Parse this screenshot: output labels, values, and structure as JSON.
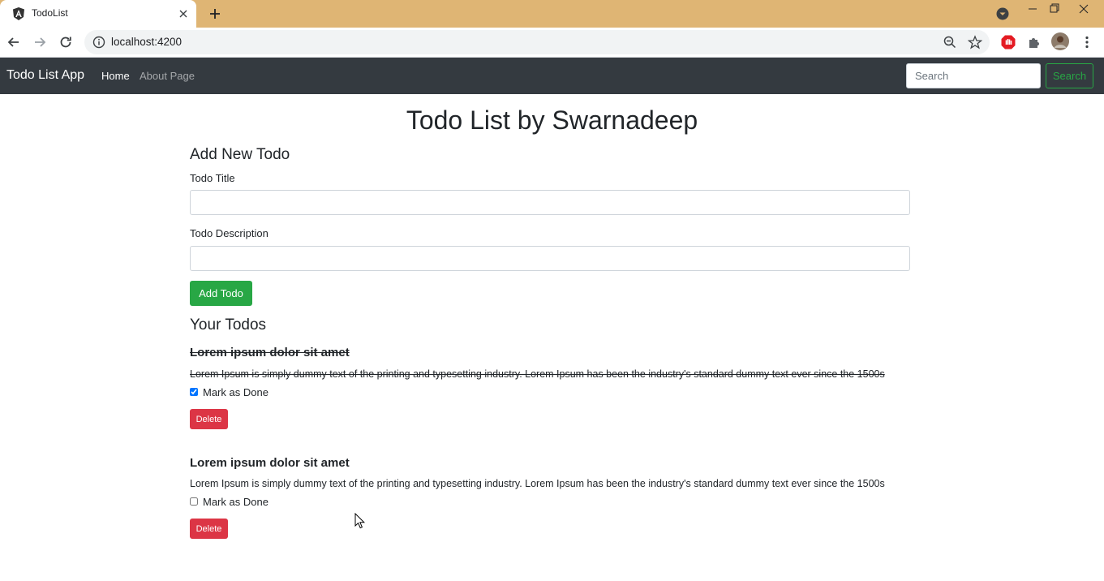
{
  "browser": {
    "tab_title": "TodoList",
    "url": "localhost:4200",
    "icons": [
      "angular-favicon",
      "close-icon",
      "plus-icon",
      "tab-search-icon",
      "minimize-icon",
      "restore-icon",
      "window-close-icon",
      "back-arrow-icon",
      "forward-arrow-icon",
      "reload-icon",
      "info-icon",
      "zoom-icon",
      "star-icon",
      "adblock-icon",
      "extensions-icon",
      "avatar",
      "kebab-menu-icon"
    ],
    "colors": {
      "tab_strip": "#dfb574",
      "close_hover": "#e81123"
    }
  },
  "navbar": {
    "brand": "Todo List App",
    "links": [
      {
        "label": "Home",
        "active": true
      },
      {
        "label": "About Page",
        "active": false
      }
    ],
    "search_placeholder": "Search",
    "search_button": "Search",
    "colors": {
      "background": "#343a40",
      "search_button": "#28a745"
    }
  },
  "main": {
    "title": "Todo List by Swarnadeep",
    "add_form": {
      "heading": "Add New Todo",
      "title_label": "Todo Title",
      "title_value": "",
      "description_label": "Todo Description",
      "description_value": "",
      "submit_label": "Add Todo"
    },
    "todos_heading": "Your Todos",
    "todos": [
      {
        "title": "Lorem ipsum dolor sit amet",
        "description": "Lorem Ipsum is simply dummy text of the printing and typesetting industry. Lorem Ipsum has been the industry's standard dummy text ever since the 1500s",
        "done_label": "Mark as Done",
        "done": true,
        "delete_label": "Delete"
      },
      {
        "title": "Lorem ipsum dolor sit amet",
        "description": "Lorem Ipsum is simply dummy text of the printing and typesetting industry. Lorem Ipsum has been the industry's standard dummy text ever since the 1500s",
        "done_label": "Mark as Done",
        "done": false,
        "delete_label": "Delete"
      }
    ],
    "colors": {
      "success": "#28a745",
      "danger": "#dc3545"
    }
  }
}
